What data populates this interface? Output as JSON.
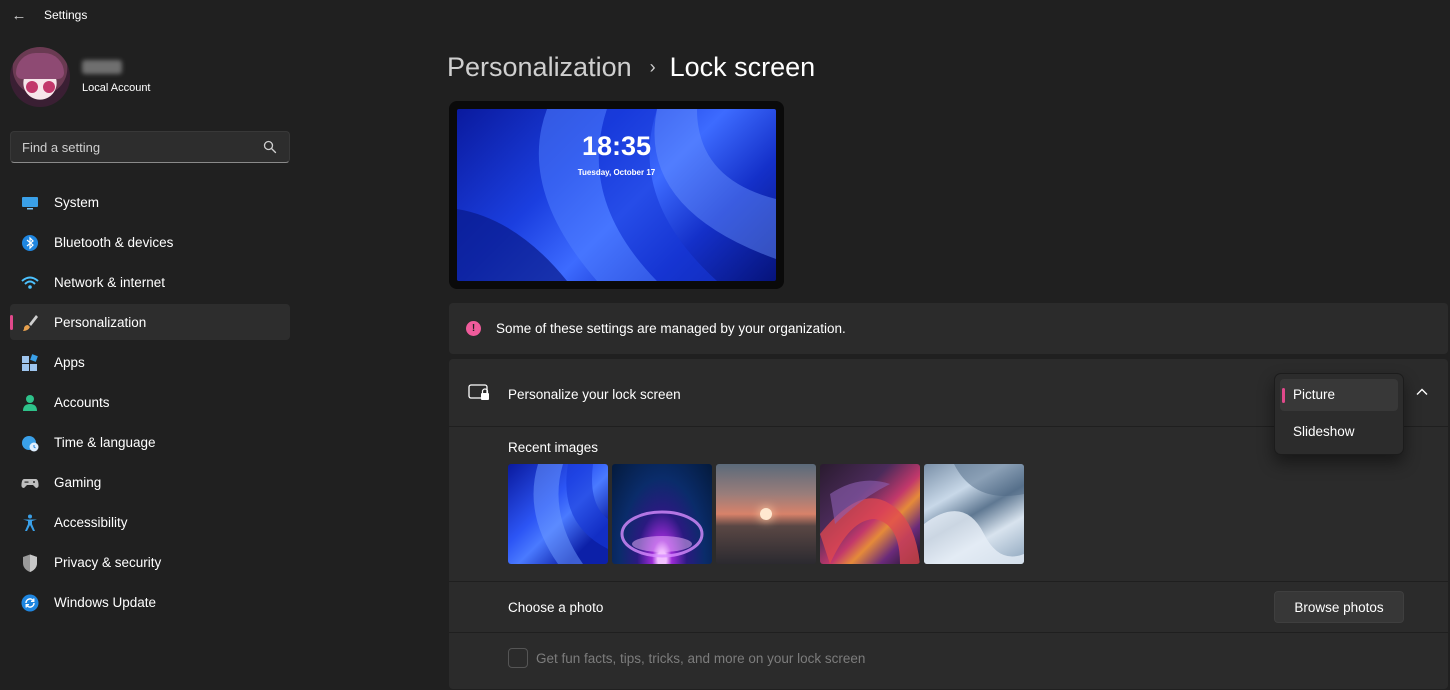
{
  "window": {
    "title": "Settings",
    "back_glyph": "←"
  },
  "profile": {
    "account_type": "Local Account"
  },
  "search": {
    "placeholder": "Find a setting"
  },
  "sidebar": {
    "items": [
      {
        "label": "System",
        "icon": "system-icon",
        "color": "#3aa0e8"
      },
      {
        "label": "Bluetooth & devices",
        "icon": "bluetooth-icon",
        "color": "#1f86e0"
      },
      {
        "label": "Network & internet",
        "icon": "wifi-icon",
        "color": "#4cc2ff"
      },
      {
        "label": "Personalization",
        "icon": "brush-icon",
        "color": "#e7a04e",
        "active": true
      },
      {
        "label": "Apps",
        "icon": "apps-icon",
        "color": "#9ec5ee"
      },
      {
        "label": "Accounts",
        "icon": "accounts-icon",
        "color": "#2ec28a"
      },
      {
        "label": "Time & language",
        "icon": "globe-clock-icon",
        "color": "#3aa0e8"
      },
      {
        "label": "Gaming",
        "icon": "gamepad-icon",
        "color": "#bfbfbf"
      },
      {
        "label": "Accessibility",
        "icon": "accessibility-icon",
        "color": "#3aa0e8"
      },
      {
        "label": "Privacy & security",
        "icon": "shield-icon",
        "color": "#9a9a9a"
      },
      {
        "label": "Windows Update",
        "icon": "update-icon",
        "color": "#1f86e0"
      }
    ]
  },
  "breadcrumb": {
    "parent": "Personalization",
    "separator": "›",
    "current": "Lock screen"
  },
  "preview": {
    "time": "18:35",
    "date": "Tuesday, October 17"
  },
  "info_bar": {
    "icon_glyph": "!",
    "text": "Some of these settings are managed by your organization."
  },
  "lock_screen": {
    "title": "Personalize your lock screen",
    "recent_images_label": "Recent images",
    "choose_photo_label": "Choose a photo",
    "browse_button": "Browse photos",
    "fun_facts_label": "Get fun facts, tips, tricks, and more on your lock screen",
    "fun_facts_checked": false
  },
  "dropdown": {
    "options": [
      "Picture",
      "Slideshow"
    ],
    "selected": "Picture"
  },
  "colors": {
    "accent": "#e1498b",
    "info": "#ef5b9b",
    "background": "#202020",
    "card": "#2b2b2b"
  }
}
